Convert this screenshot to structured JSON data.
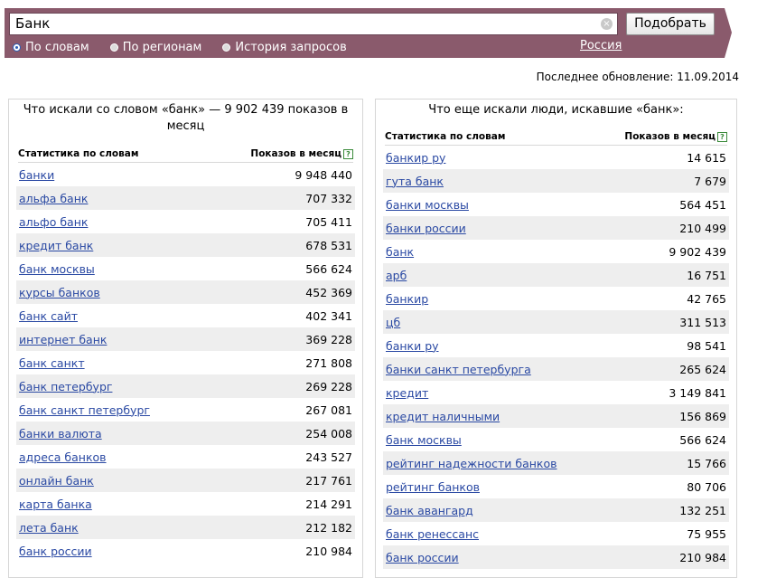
{
  "search": {
    "value": "Банк",
    "submit_label": "Подобрать",
    "clear_icon": "×"
  },
  "modes": [
    {
      "label": "По словам",
      "selected": true
    },
    {
      "label": "По регионам",
      "selected": false
    },
    {
      "label": "История запросов",
      "selected": false
    }
  ],
  "region": "Россия",
  "updated": "Последнее обновление: 11.09.2014",
  "colors": {
    "band": "#8a5a6c",
    "link": "#2a49a3",
    "row_alt": "#eeeeee"
  },
  "left_panel": {
    "title": "Что искали со словом «банк» — 9 902 439 показов в месяц",
    "col_query": "Статистика по словам",
    "col_count": "Показов в месяц",
    "rows": [
      {
        "q": "банки",
        "n": "9 948 440"
      },
      {
        "q": "альфа банк",
        "n": "707 332"
      },
      {
        "q": "альфо банк",
        "n": "705 411"
      },
      {
        "q": "кредит банк",
        "n": "678 531"
      },
      {
        "q": "банк москвы",
        "n": "566 624"
      },
      {
        "q": "курсы банков",
        "n": "452 369"
      },
      {
        "q": "банк сайт",
        "n": "402 341"
      },
      {
        "q": "интернет банк",
        "n": "369 228"
      },
      {
        "q": "банк санкт",
        "n": "271 808"
      },
      {
        "q": "банк петербург",
        "n": "269 228"
      },
      {
        "q": "банк санкт петербург",
        "n": "267 081"
      },
      {
        "q": "банки валюта",
        "n": "254 008"
      },
      {
        "q": "адреса банков",
        "n": "243 527"
      },
      {
        "q": "онлайн банк",
        "n": "217 761"
      },
      {
        "q": "карта банка",
        "n": "214 291"
      },
      {
        "q": "лета банк",
        "n": "212 182"
      },
      {
        "q": "банк россии",
        "n": "210 984"
      }
    ]
  },
  "right_panel": {
    "title": "Что еще искали люди, искавшие «банк»:",
    "col_query": "Статистика по словам",
    "col_count": "Показов в месяц",
    "rows": [
      {
        "q": "банкир ру",
        "n": "14 615"
      },
      {
        "q": "гута банк",
        "n": "7 679"
      },
      {
        "q": "банки москвы",
        "n": "564 451"
      },
      {
        "q": "банки россии",
        "n": "210 499"
      },
      {
        "q": "банк",
        "n": "9 902 439"
      },
      {
        "q": "арб",
        "n": "16 751"
      },
      {
        "q": "банкир",
        "n": "42 765"
      },
      {
        "q": "цб",
        "n": "311 513"
      },
      {
        "q": "банки ру",
        "n": "98 541"
      },
      {
        "q": "банки санкт петербурга",
        "n": "265 624"
      },
      {
        "q": "кредит",
        "n": "3 149 841"
      },
      {
        "q": "кредит наличными",
        "n": "156 869"
      },
      {
        "q": "банк москвы",
        "n": "566 624"
      },
      {
        "q": "рейтинг надежности банков",
        "n": "15 766"
      },
      {
        "q": "рейтинг банков",
        "n": "80 706"
      },
      {
        "q": "банк авангард",
        "n": "132 251"
      },
      {
        "q": "банк ренессанс",
        "n": "75 955"
      },
      {
        "q": "банк россии",
        "n": "210 984"
      }
    ]
  }
}
